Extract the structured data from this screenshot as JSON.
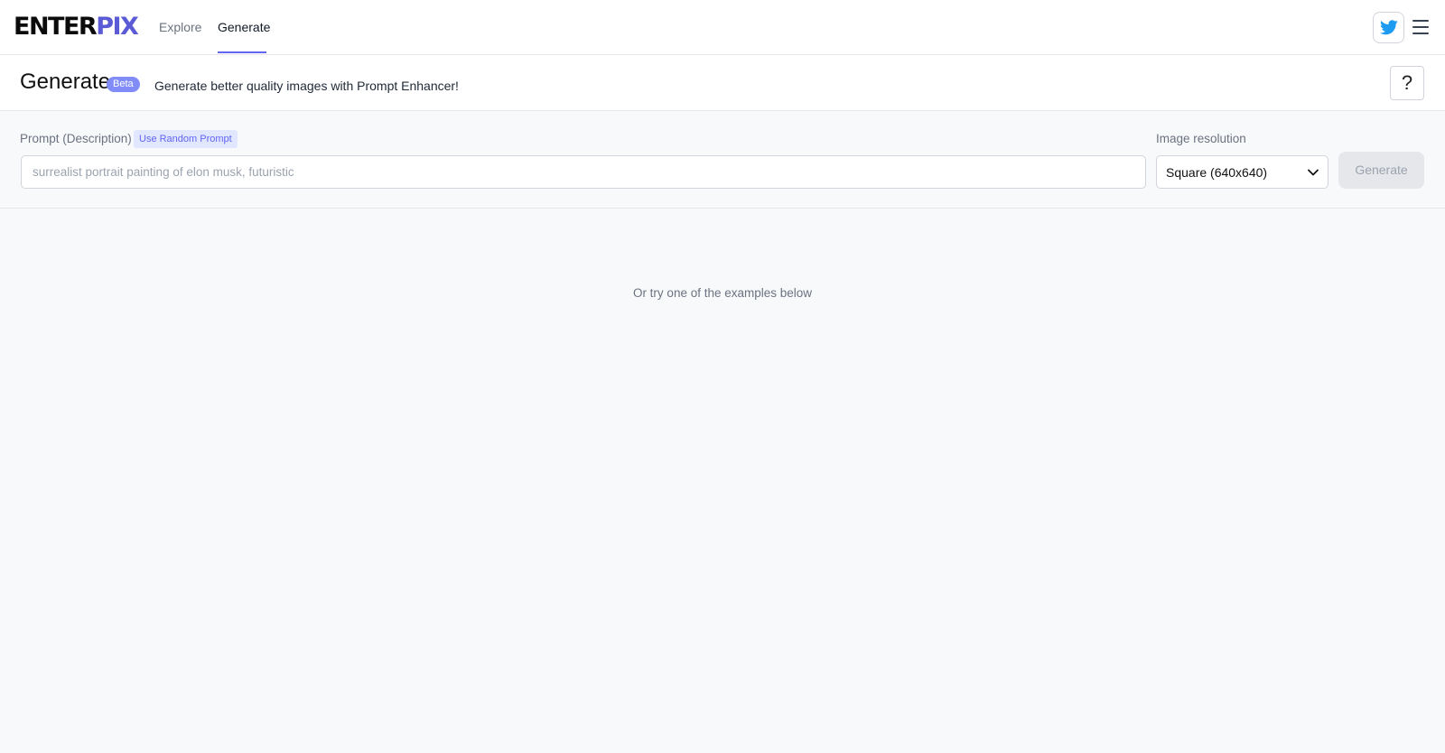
{
  "brand": {
    "logo_part1": "ENTER",
    "logo_part2": "PIX",
    "logo_color_dark": "#0b0b0b",
    "logo_color_accent": "#5b5bd6"
  },
  "nav": {
    "items": [
      {
        "label": "Explore",
        "active": false
      },
      {
        "label": "Generate",
        "active": true
      }
    ],
    "active_color": "#6366f1"
  },
  "header_icons": {
    "twitter": "twitter-icon",
    "menu": "hamburger-menu-icon",
    "twitter_color": "#1d9bf0"
  },
  "page": {
    "title": "Generate",
    "badge": "Beta",
    "tagline": "Generate better quality images with Prompt Enhancer!",
    "help_label": "?"
  },
  "form": {
    "prompt_label": "Prompt (Description)",
    "random_prompt_label": "Use Random Prompt",
    "prompt_placeholder": "surrealist portrait painting of elon musk, futuristic",
    "prompt_value": "",
    "resolution_label": "Image resolution",
    "resolution_value": "Square (640x640)",
    "generate_label": "Generate"
  },
  "examples_hint": "Or try one of the examples below"
}
